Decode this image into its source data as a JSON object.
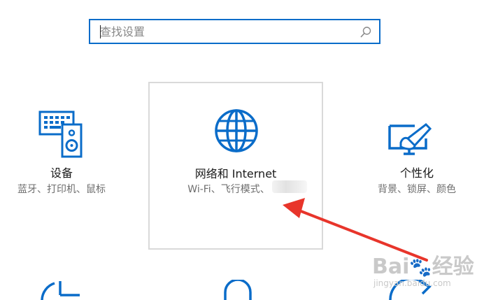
{
  "search": {
    "placeholder": "查找设置"
  },
  "tiles": [
    {
      "name": "设备",
      "desc": "蓝牙、打印机、鼠标"
    },
    {
      "name": "网络和 Internet",
      "desc": "Wi-Fi、飞行模式、"
    },
    {
      "name": "个性化",
      "desc": "背景、锁屏、颜色"
    }
  ],
  "watermark": {
    "brand": "Bai",
    "suffix": "经验",
    "url": "jingyan.baidu.com"
  },
  "colors": {
    "accent": "#0a6cc9",
    "annotation_arrow": "#e8352b"
  }
}
